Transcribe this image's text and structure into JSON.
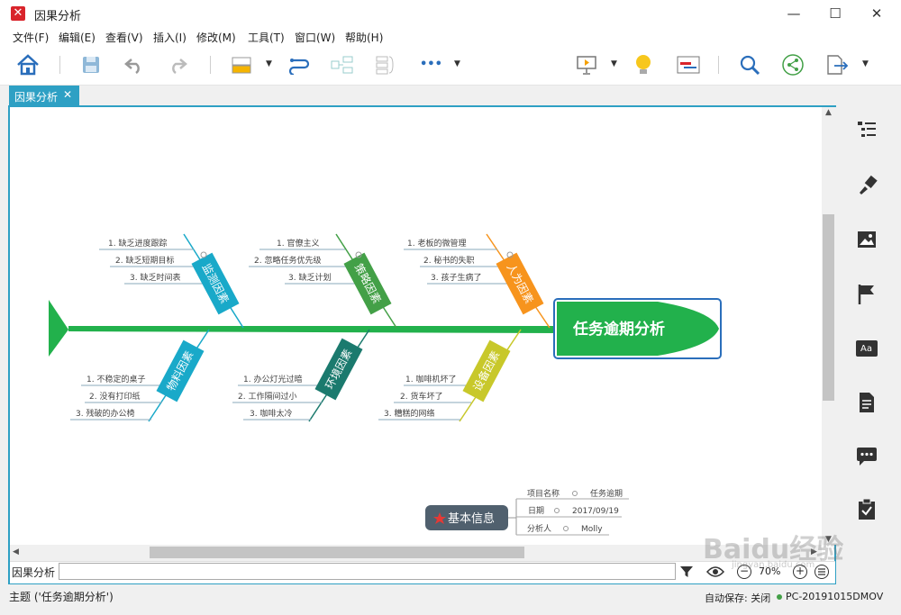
{
  "window": {
    "title": "因果分析",
    "minimize": "—",
    "maximize": "☐",
    "close": "✕"
  },
  "menu": [
    "文件(F)",
    "编辑(E)",
    "查看(V)",
    "插入(I)",
    "修改(M)",
    "工具(T)",
    "窗口(W)",
    "帮助(H)"
  ],
  "toolbar": {
    "more": "•••"
  },
  "tab": {
    "label": "因果分析",
    "close": "✕"
  },
  "fishbone": {
    "head": "任务逾期分析",
    "categories": [
      {
        "label": "监测因素",
        "color": "#19a9c9",
        "items": [
          "1. 缺乏进度跟踪",
          "2. 缺乏短期目标",
          "3. 缺乏时间表"
        ]
      },
      {
        "label": "策略因素",
        "color": "#43a047",
        "items": [
          "1. 官僚主义",
          "2. 忽略任务优先级",
          "3. 缺乏计划"
        ]
      },
      {
        "label": "人为因素",
        "color": "#f7941d",
        "items": [
          "1. 老板的微管理",
          "2. 秘书的失职",
          "3. 孩子生病了"
        ]
      },
      {
        "label": "物料因素",
        "color": "#19a9c9",
        "items": [
          "1. 不稳定的桌子",
          "2. 没有打印纸",
          "3. 残破的办公椅"
        ]
      },
      {
        "label": "环境因素",
        "color": "#1b7a6e",
        "items": [
          "1. 办公灯光过暗",
          "2. 工作隔间过小",
          "3. 咖啡太冷"
        ]
      },
      {
        "label": "设备因素",
        "color": "#c8c82a",
        "items": [
          "1. 咖啡机坏了",
          "2. 货车坏了",
          "3. 糟糕的网络"
        ]
      }
    ]
  },
  "info": {
    "title": "基本信息",
    "rows": [
      {
        "key": "项目名称",
        "value": "任务逾期"
      },
      {
        "key": "日期",
        "value": "2017/09/19"
      },
      {
        "key": "分析人",
        "value": "Molly"
      }
    ]
  },
  "bottom": {
    "sheet": "因果分析",
    "zoom": "70%",
    "minus": "−",
    "plus": "+"
  },
  "status": {
    "topic": "主题 ('任务逾期分析')",
    "autosave": "自动保存: 关闭",
    "pc": "PC-20191015DMOV"
  },
  "watermark": "Baidu经验",
  "watermark_sub": "jingyan.baidu.com"
}
